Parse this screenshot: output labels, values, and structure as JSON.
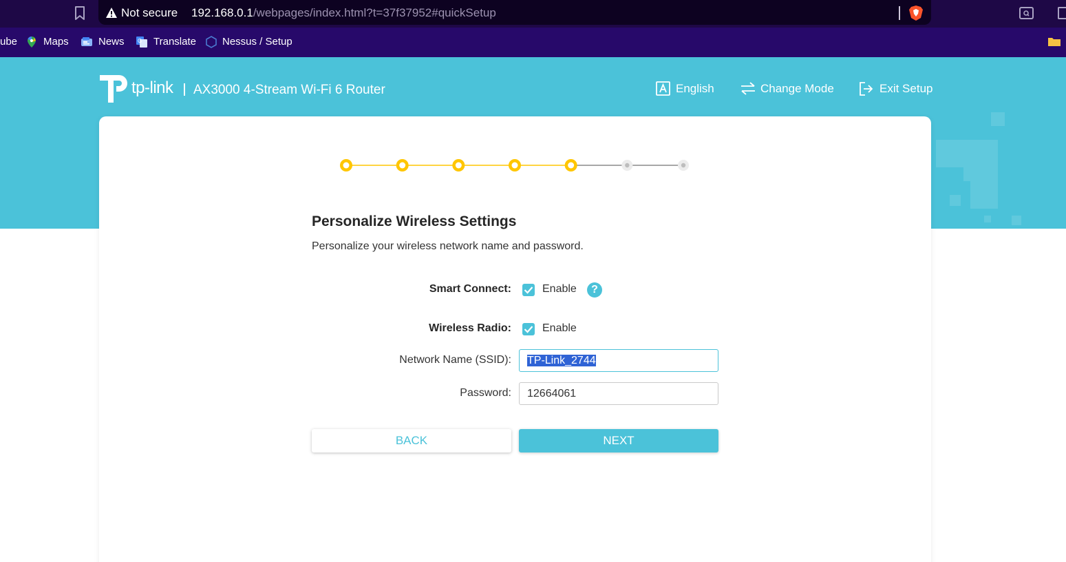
{
  "browser": {
    "security_label": "Not secure",
    "url_host": "192.168.0.1",
    "url_path": "/webpages/index.html?t=37f37952#quickSetup"
  },
  "bookmarks": [
    {
      "label": "ube",
      "icon": "youtube-partial"
    },
    {
      "label": "Maps",
      "icon": "maps-pin-icon"
    },
    {
      "label": "News",
      "icon": "news-icon"
    },
    {
      "label": "Translate",
      "icon": "translate-icon"
    },
    {
      "label": "Nessus / Setup",
      "icon": "nessus-icon"
    }
  ],
  "header": {
    "brand": "tp-link",
    "model": "AX3000 4-Stream Wi-Fi 6 Router",
    "language_label": "English",
    "change_mode_label": "Change Mode",
    "exit_setup_label": "Exit Setup"
  },
  "progress": {
    "total_steps": 7,
    "completed_steps": 5,
    "active_color": "#ffc600",
    "inactive_color": "#bdbdbd"
  },
  "form": {
    "title": "Personalize Wireless Settings",
    "description": "Personalize your wireless network name and password.",
    "smart_connect_label": "Smart Connect:",
    "smart_connect_enable": "Enable",
    "smart_connect_checked": true,
    "wireless_radio_label": "Wireless Radio:",
    "wireless_radio_enable": "Enable",
    "wireless_radio_checked": true,
    "ssid_label": "Network Name (SSID):",
    "ssid_value": "TP-Link_2744",
    "password_label": "Password:",
    "password_value": "12664061"
  },
  "buttons": {
    "back": "BACK",
    "next": "NEXT"
  },
  "colors": {
    "accent": "#4bc2d9",
    "browser_bg": "#1e0846",
    "bookmarks_bg": "#27096a"
  }
}
